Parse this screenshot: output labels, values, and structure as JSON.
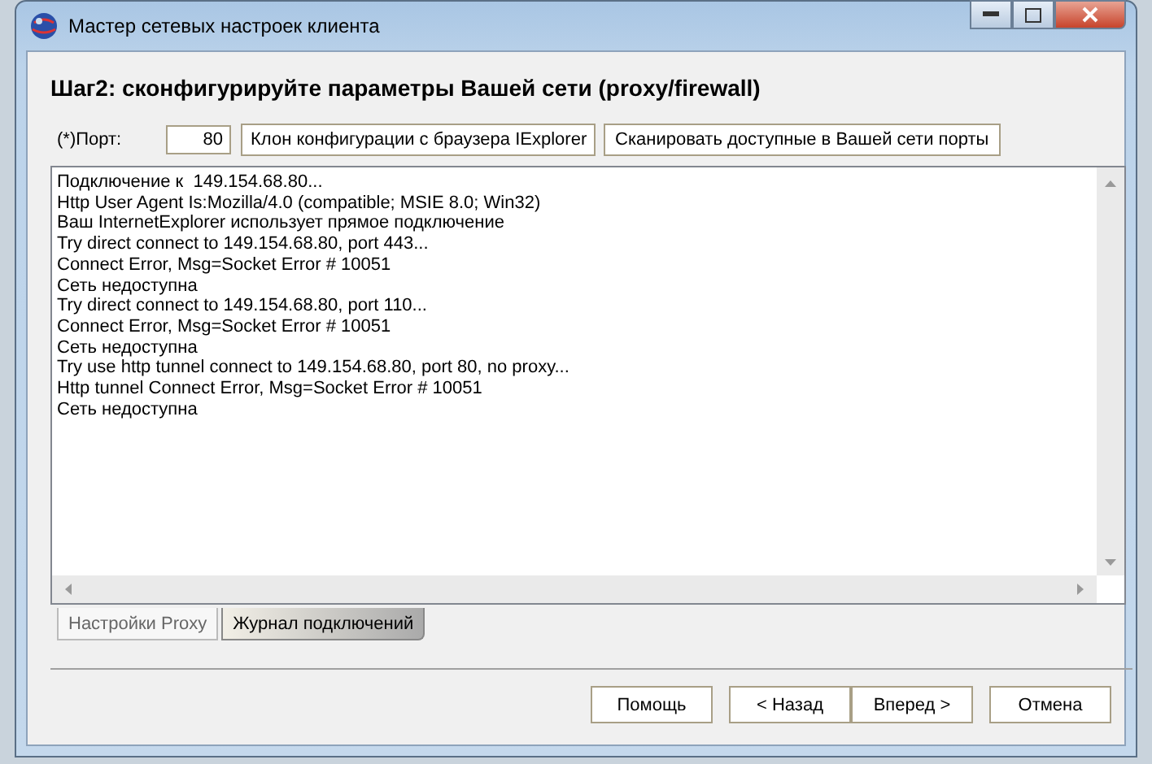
{
  "window": {
    "title": "Мастер сетевых настроек клиента"
  },
  "heading": "Шаг2: сконфигурируйте параметры Вашей сети (proxy/firewall)",
  "port": {
    "label": "(*)Порт:",
    "value": "80"
  },
  "toolbar_buttons": [
    "Клон конфигурации с браузера IExplorer",
    "Сканировать доступные в Вашей сети порты"
  ],
  "log_lines": [
    "Подключение к  149.154.68.80...",
    "Http User Agent Is:Mozilla/4.0 (compatible; MSIE 8.0; Win32)",
    "Ваш InternetExplorer использует прямое подключение",
    "Try direct connect to 149.154.68.80, port 443...",
    "Connect Error, Msg=Socket Error # 10051",
    "Сеть недоступна",
    "Try direct connect to 149.154.68.80, port 110...",
    "Connect Error, Msg=Socket Error # 10051",
    "Сеть недоступна",
    "Try use http tunnel connect to 149.154.68.80, port 80, no proxy...",
    "Http tunnel Connect Error, Msg=Socket Error # 10051",
    "Сеть недоступна"
  ],
  "tabs": [
    {
      "label": "Настройки Proxy",
      "selected": false
    },
    {
      "label": "Журнал подключений",
      "selected": true
    }
  ],
  "buttons": [
    "Помощь",
    "< Назад",
    "Вперед >",
    "Отмена"
  ]
}
